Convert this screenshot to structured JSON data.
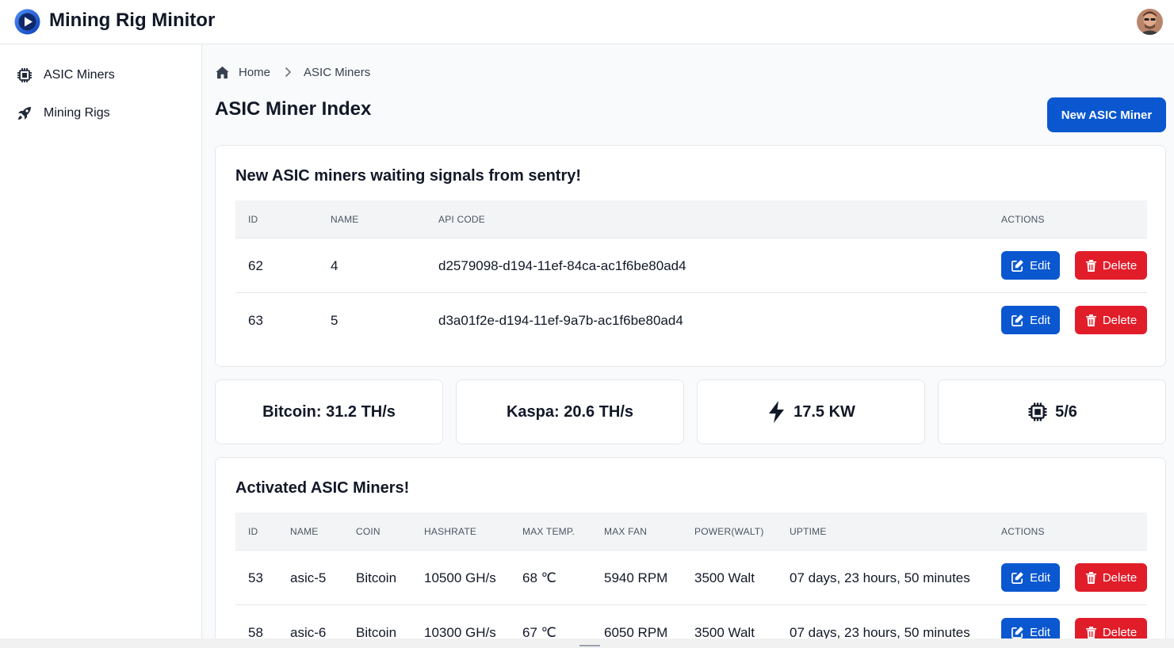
{
  "app": {
    "title": "Mining Rig Minitor"
  },
  "sidebar": {
    "items": [
      {
        "label": "ASIC Miners",
        "icon": "chip-icon"
      },
      {
        "label": "Mining Rigs",
        "icon": "rocket-icon"
      }
    ]
  },
  "breadcrumb": {
    "home": "Home",
    "current": "ASIC Miners"
  },
  "page": {
    "title": "ASIC Miner Index",
    "new_button": "New ASIC Miner"
  },
  "pending": {
    "title": "New ASIC miners waiting signals from sentry!",
    "columns": [
      "ID",
      "NAME",
      "API CODE",
      "ACTIONS"
    ],
    "rows": [
      {
        "id": "62",
        "name": "4",
        "api_code": "d2579098-d194-11ef-84ca-ac1f6be80ad4"
      },
      {
        "id": "63",
        "name": "5",
        "api_code": "d3a01f2e-d194-11ef-9a7b-ac1f6be80ad4"
      }
    ]
  },
  "stats": {
    "bitcoin": "Bitcoin: 31.2 TH/s",
    "kaspa": "Kaspa: 20.6 TH/s",
    "power": "17.5 KW",
    "miners": "5/6"
  },
  "active": {
    "title": "Activated ASIC Miners!",
    "columns": [
      "ID",
      "NAME",
      "COIN",
      "HASHRATE",
      "MAX TEMP.",
      "MAX FAN",
      "POWER(WALT)",
      "UPTIME",
      "ACTIONS"
    ],
    "rows": [
      {
        "id": "53",
        "name": "asic-5",
        "coin": "Bitcoin",
        "hashrate": "10500 GH/s",
        "max_temp": "68 ℃",
        "max_fan": "5940 RPM",
        "power": "3500 Walt",
        "uptime": "07 days, 23 hours, 50 minutes"
      },
      {
        "id": "58",
        "name": "asic-6",
        "coin": "Bitcoin",
        "hashrate": "10300 GH/s",
        "max_temp": "67 ℃",
        "max_fan": "6050 RPM",
        "power": "3500 Walt",
        "uptime": "07 days, 23 hours, 50 minutes"
      }
    ]
  },
  "actions": {
    "edit": "Edit",
    "delete": "Delete"
  },
  "colors": {
    "primary": "#0b57d0",
    "danger": "#e11d2a",
    "border": "#e5e7eb",
    "page_bg": "#f9fafb"
  }
}
